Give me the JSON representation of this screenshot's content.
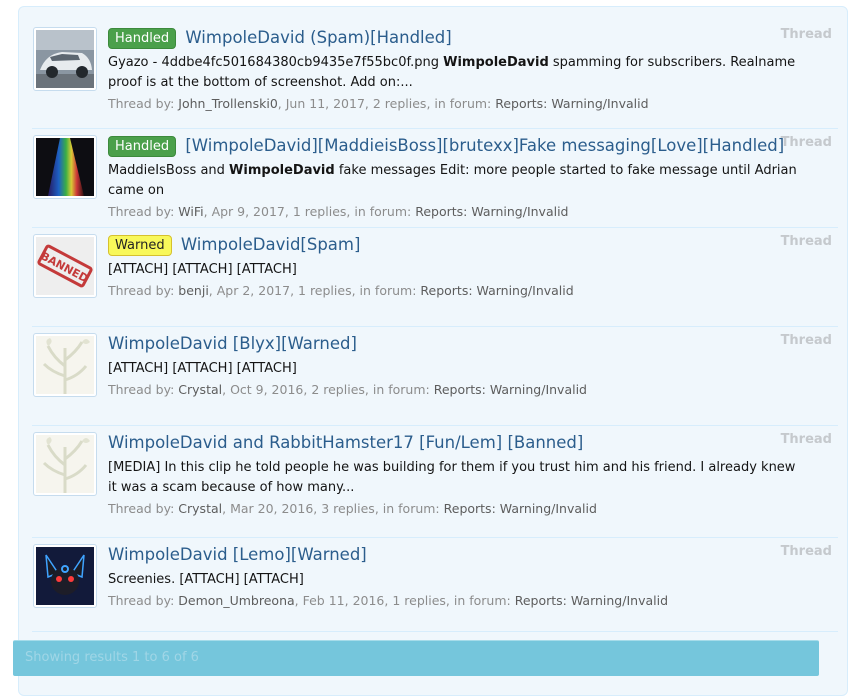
{
  "results": [
    {
      "prefix": "Handled",
      "prefix_kind": "handled",
      "title_highlight": "WimpoleDavid",
      "title_rest": " (Spam)[Handled]",
      "type": "Thread",
      "snippet_a": "Gyazo - 4ddbe4fc501684380cb9435e7f55bc0f.png ",
      "snippet_bold": "WimpoleDavid",
      "snippet_b": " spamming for subscribers. Realname proof is at the bottom of screenshot. Add on:...",
      "meta_label": "Thread by: ",
      "author": "John_Trollenski0",
      "date": "Jun 11, 2017",
      "replies": "2 replies",
      "forum_label": "in forum: ",
      "forum": "Reports: Warning/Invalid",
      "avatar": "car-thumbnail-icon"
    },
    {
      "prefix": "Handled",
      "prefix_kind": "handled",
      "title_highlight": "",
      "title_rest": "[WimpoleDavid][MaddieisBoss][brutexx]Fake messaging[Love][Handled]",
      "type": "Thread",
      "snippet_a": "MaddieIsBoss and ",
      "snippet_bold": "WimpoleDavid",
      "snippet_b": " fake messages Edit: more people started to fake message until Adrian came on",
      "meta_label": "Thread by: ",
      "author": "WiFi",
      "date": "Apr 9, 2017",
      "replies": "1 replies",
      "forum_label": "in forum: ",
      "forum": "Reports: Warning/Invalid",
      "avatar": "rainbow-light-icon"
    },
    {
      "prefix": "Warned",
      "prefix_kind": "warned",
      "title_highlight": "WimpoleDavid",
      "title_rest": "[Spam]",
      "type": "Thread",
      "snippet_a": "[ATTACH] [ATTACH] [ATTACH]",
      "snippet_bold": "",
      "snippet_b": "",
      "meta_label": "Thread by: ",
      "author": "benji",
      "date": "Apr 2, 2017",
      "replies": "1 replies",
      "forum_label": "in forum: ",
      "forum": "Reports: Warning/Invalid",
      "avatar": "banned-stamp-icon",
      "avatar_text": "BANNED"
    },
    {
      "prefix": "",
      "prefix_kind": "",
      "title_highlight": "WimpoleDavid",
      "title_rest": " [Blyx][Warned]",
      "type": "Thread",
      "snippet_a": "[ATTACH] [ATTACH] [ATTACH]",
      "snippet_bold": "",
      "snippet_b": "",
      "meta_label": "Thread by: ",
      "author": "Crystal",
      "date": "Oct 9, 2016",
      "replies": "2 replies",
      "forum_label": "in forum: ",
      "forum": "Reports: Warning/Invalid",
      "avatar": "plant-sketch-icon"
    },
    {
      "prefix": "",
      "prefix_kind": "",
      "title_highlight": "WimpoleDavid",
      "title_rest": " and RabbitHamster17 [Fun/Lem] [Banned]",
      "type": "Thread",
      "snippet_a": "[MEDIA] In this clip he told people he was building for them if you trust him and his friend. I already knew it was a scam because of how many...",
      "snippet_bold": "",
      "snippet_b": "",
      "meta_label": "Thread by: ",
      "author": "Crystal",
      "date": "Mar 20, 2016",
      "replies": "3 replies",
      "forum_label": "in forum: ",
      "forum": "Reports: Warning/Invalid",
      "avatar": "plant-sketch-icon"
    },
    {
      "prefix": "",
      "prefix_kind": "",
      "title_highlight": "WimpoleDavid",
      "title_rest": " [Lemo][Warned]",
      "type": "Thread",
      "snippet_a": "Screenies. [ATTACH] [ATTACH]",
      "snippet_bold": "",
      "snippet_b": "",
      "meta_label": "Thread by: ",
      "author": "Demon_Umbreona",
      "date": "Feb 11, 2016",
      "replies": "1 replies",
      "forum_label": "in forum: ",
      "forum": "Reports: Warning/Invalid",
      "avatar": "umbreon-character-icon"
    }
  ],
  "footer": {
    "text": "Showing results 1 to 6 of 6"
  }
}
